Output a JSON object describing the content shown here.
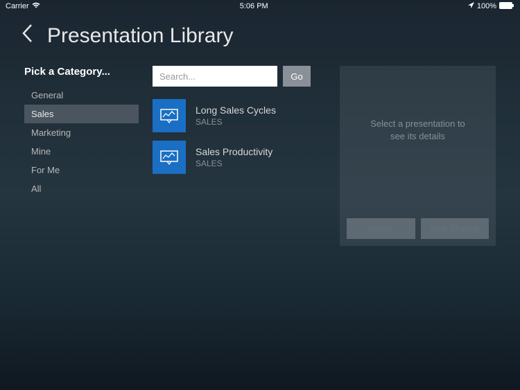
{
  "statusBar": {
    "carrier": "Carrier",
    "time": "5:06 PM",
    "battery": "100%"
  },
  "header": {
    "title": "Presentation Library"
  },
  "sidebar": {
    "title": "Pick a Category...",
    "items": [
      {
        "label": "General",
        "selected": false
      },
      {
        "label": "Sales",
        "selected": true
      },
      {
        "label": "Marketing",
        "selected": false
      },
      {
        "label": "Mine",
        "selected": false
      },
      {
        "label": "For Me",
        "selected": false
      },
      {
        "label": "All",
        "selected": false
      }
    ]
  },
  "search": {
    "placeholder": "Search...",
    "goLabel": "Go"
  },
  "presentations": [
    {
      "title": "Long Sales Cycles",
      "category": "SALES"
    },
    {
      "title": "Sales Productivity",
      "category": "SALES"
    }
  ],
  "detailPanel": {
    "emptyMsgLine1": "Select a presentation to",
    "emptyMsgLine2": "see its details",
    "importLabel": "Import",
    "stopSharingLabel": "Stop Sharing"
  }
}
